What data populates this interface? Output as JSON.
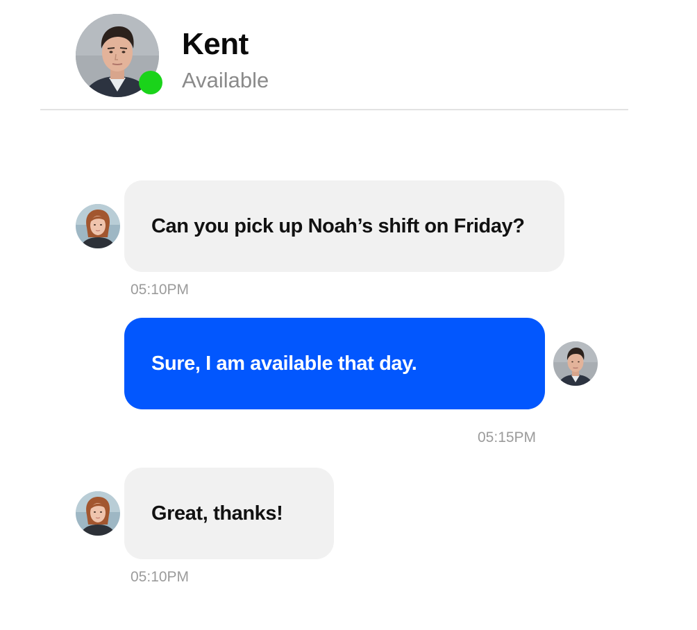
{
  "header": {
    "name": "Kent",
    "status": "Available",
    "status_color": "#1ad31a",
    "avatar_icon": "man-avatar"
  },
  "colors": {
    "incoming_bubble": "#f1f1f1",
    "outgoing_bubble": "#0257fe",
    "timestamp": "#9b9b9b"
  },
  "messages": [
    {
      "direction": "incoming",
      "avatar_icon": "woman-avatar",
      "text": "Can you pick up Noah’s shift on Friday?",
      "time": "05:10PM"
    },
    {
      "direction": "outgoing",
      "avatar_icon": "man-avatar",
      "text": "Sure, I am available that day.",
      "time": "05:15PM"
    },
    {
      "direction": "incoming",
      "avatar_icon": "woman-avatar",
      "text": "Great, thanks!",
      "time": "05:10PM"
    }
  ]
}
